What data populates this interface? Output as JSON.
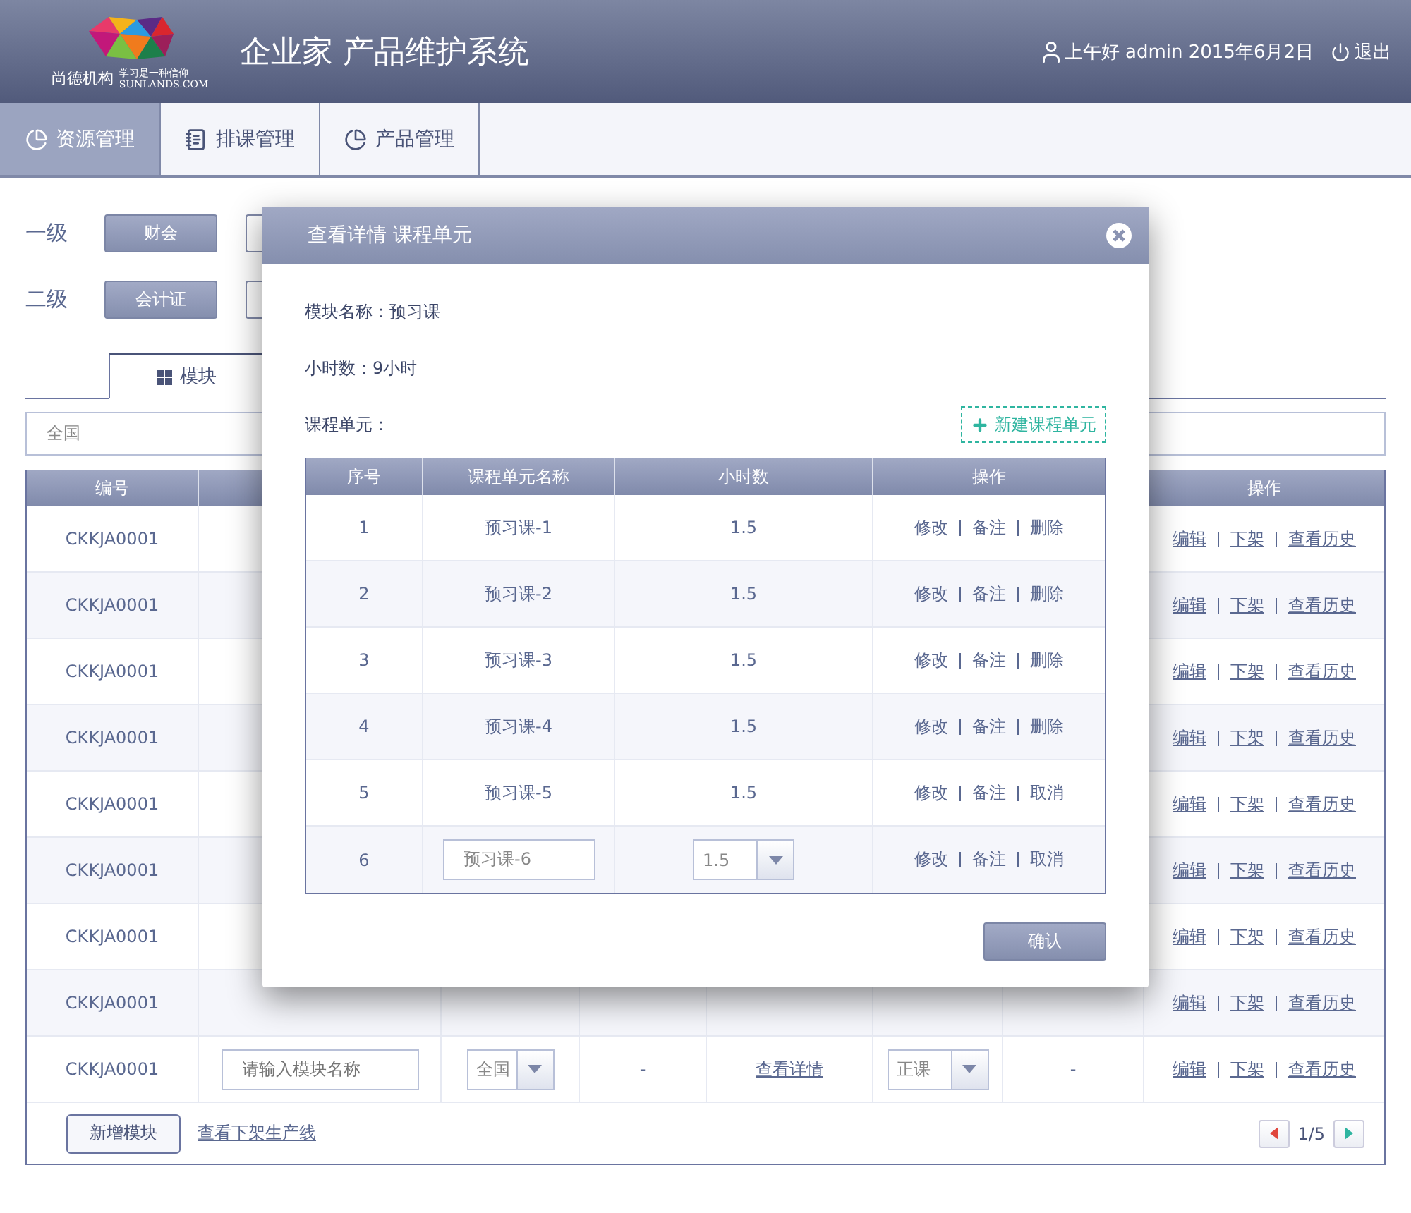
{
  "header": {
    "logo": {
      "name": "尚德机构",
      "tagline": "学习是一种信仰",
      "site": "SUNLANDS.COM"
    },
    "title": "企业家 产品维护系统",
    "greeting": "上午好 admin 2015年6月2日",
    "logout": "退出"
  },
  "nav": [
    {
      "label": "资源管理",
      "selected": true
    },
    {
      "label": "排课管理",
      "selected": false
    },
    {
      "label": "产品管理",
      "selected": false
    }
  ],
  "filters": [
    {
      "label": "一级",
      "options": [
        {
          "label": "财会",
          "selected": true
        },
        {
          "selected": false
        }
      ]
    },
    {
      "label": "二级",
      "options": [
        {
          "label": "会计证",
          "selected": true
        },
        {
          "selected": false
        }
      ]
    }
  ],
  "view_tab": {
    "label": "模块",
    "selected": true
  },
  "region_field": {
    "value": "全国"
  },
  "table": {
    "columns": [
      "编号",
      "操作"
    ],
    "rows": [
      {
        "code": "CKKJA0001",
        "actions": [
          "编辑",
          "下架",
          "查看历史"
        ]
      },
      {
        "code": "CKKJA0001",
        "actions": [
          "编辑",
          "下架",
          "查看历史"
        ]
      },
      {
        "code": "CKKJA0001",
        "actions": [
          "编辑",
          "下架",
          "查看历史"
        ]
      },
      {
        "code": "CKKJA0001",
        "actions": [
          "编辑",
          "下架",
          "查看历史"
        ]
      },
      {
        "code": "CKKJA0001",
        "actions": [
          "编辑",
          "下架",
          "查看历史"
        ]
      },
      {
        "code": "CKKJA0001",
        "actions": [
          "编辑",
          "下架",
          "查看历史"
        ]
      },
      {
        "code": "CKKJA0001",
        "actions": [
          "编辑",
          "下架",
          "查看历史"
        ]
      },
      {
        "code": "CKKJA0001",
        "actions": [
          "编辑",
          "下架",
          "查看历史"
        ]
      },
      {
        "code": "CKKJA0001",
        "kind": "edit",
        "name_placeholder": "请输入模块名称",
        "region": "全国",
        "count": "-",
        "detail_link": "查看详情",
        "type": "正课",
        "note": "-",
        "actions": [
          "编辑",
          "下架",
          "查看历史"
        ]
      }
    ]
  },
  "footer": {
    "add_button": "新增模块",
    "offline_link": "查看下架生产线",
    "page": "1/5"
  },
  "dialog": {
    "title": "查看详情 课程单元",
    "module_name": "模块名称：预习课",
    "hours": "小时数：9小时",
    "units_label": "课程单元：",
    "new_unit_button": "新建课程单元",
    "columns": [
      "序号",
      "课程单元名称",
      "小时数",
      "操作"
    ],
    "rows": [
      {
        "kind": "text",
        "index": "1",
        "name": "预习课-1",
        "hours": "1.5",
        "actions": [
          "修改",
          "备注",
          "删除"
        ]
      },
      {
        "kind": "text",
        "index": "2",
        "name": "预习课-2",
        "hours": "1.5",
        "actions": [
          "修改",
          "备注",
          "删除"
        ]
      },
      {
        "kind": "text",
        "index": "3",
        "name": "预习课-3",
        "hours": "1.5",
        "actions": [
          "修改",
          "备注",
          "删除"
        ]
      },
      {
        "kind": "text",
        "index": "4",
        "name": "预习课-4",
        "hours": "1.5",
        "actions": [
          "修改",
          "备注",
          "删除"
        ]
      },
      {
        "kind": "text",
        "index": "5",
        "name": "预习课-5",
        "hours": "1.5",
        "actions": [
          "修改",
          "备注",
          "取消"
        ]
      },
      {
        "kind": "edit",
        "index": "6",
        "name": "预习课-6",
        "hours": "1.5",
        "actions": [
          "修改",
          "备注",
          "取消"
        ]
      }
    ],
    "confirm_button": "确认"
  }
}
